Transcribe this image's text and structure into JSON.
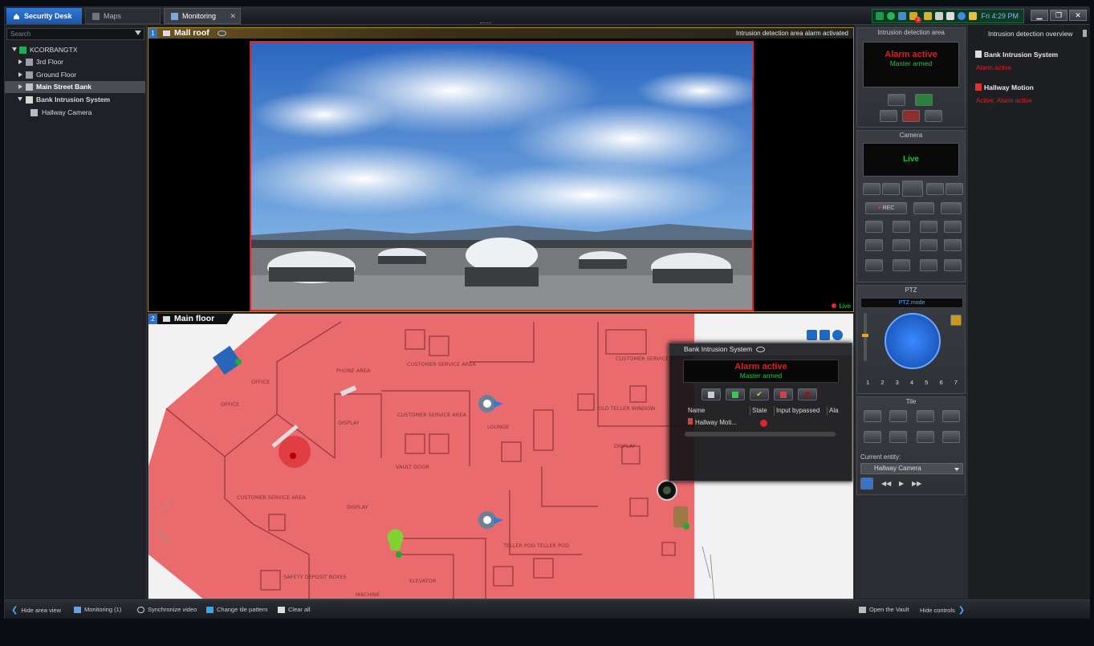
{
  "tabs": [
    {
      "label": "Security Desk"
    },
    {
      "label": "Maps"
    },
    {
      "label": "Monitoring"
    }
  ],
  "tray": {
    "badge": "2",
    "clock": "Fri 4:29 PM"
  },
  "search": {
    "placeholder": "Search"
  },
  "tree": [
    {
      "label": "KCORBANGTX"
    },
    {
      "label": "3rd Floor"
    },
    {
      "label": "Ground Floor"
    },
    {
      "label": "Main Street Bank"
    },
    {
      "label": "Bank Intrusion System"
    },
    {
      "label": "Hallway Camera"
    }
  ],
  "tile1": {
    "num": "1",
    "title": "Mall roof",
    "status": "Intrusion detection area alarm activated",
    "live": "Live"
  },
  "tile2": {
    "num": "2",
    "title": "Main floor"
  },
  "map_labels": [
    "OFFICE",
    "OFFICE",
    "PHONE AREA",
    "DISPLAY",
    "CUSTOMER SERVICE AREA",
    "CUSTOMER SERVICE AREA",
    "LOUNGE",
    "VAULT DOOR",
    "CUSTOMER SERVICE AREA",
    "DISPLAY",
    "OLD TELLER WINDOW",
    "CUSTOMER SERVICE AREA",
    "DISPLAY",
    "TELLER POD",
    "TELLER POD",
    "ELEVATOR",
    "SAFETY DEPOSIT BOXES",
    "MACHINE"
  ],
  "popup": {
    "title": "Bank Intrusion System",
    "alarm": "Alarm active",
    "armed": "Master armed",
    "columns": [
      "Name",
      "State",
      "Input bypassed",
      "Ala"
    ],
    "row": {
      "name": "Hallway Moti..."
    }
  },
  "right": {
    "ida_title": "Intrusion detection area",
    "alarm": "Alarm active",
    "armed": "Master armed",
    "camera_title": "Camera",
    "live": "Live",
    "rec": "REC",
    "ptz_title": "PTZ",
    "ptz_mode": "PTZ mode",
    "presets": [
      "1",
      "2",
      "3",
      "4",
      "5",
      "6",
      "7"
    ],
    "tile_title": "Tile",
    "current_entity_label": "Current entity:",
    "current_entity": "Hallway Camera"
  },
  "overview": {
    "title": "Intrusion detection overview",
    "items": [
      {
        "name": "Bank Intrusion System",
        "status": "Alarm active"
      },
      {
        "name": "Hallway Motion",
        "status": "Active, Alarm active"
      }
    ]
  },
  "bottom": {
    "hide_area": "Hide area view",
    "monitoring": "Monitoring (1)",
    "sync": "Synchronize video",
    "tile_pattern": "Change tile pattern",
    "clear": "Clear all",
    "vault": "Open the Vault",
    "hide_controls": "Hide controls"
  },
  "colors": {
    "accent": "#2d6fc9",
    "alarm": "#e01d25",
    "ok": "#27c44a"
  }
}
